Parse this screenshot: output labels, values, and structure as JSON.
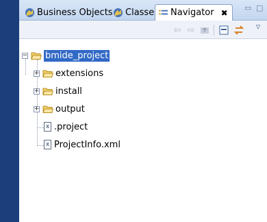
{
  "tabs": [
    {
      "label": "Business Objects",
      "icon": "business-objects-icon"
    },
    {
      "label": "Classes",
      "icon": "classes-icon"
    },
    {
      "label": "Navigator",
      "icon": "navigator-icon",
      "active": true,
      "close": "✖"
    }
  ],
  "window_controls": {
    "minimize": "▭",
    "maximize": "□",
    "menu": "▿"
  },
  "toolbar": {
    "back_icon": "back-arrow-icon",
    "forward_icon": "forward-arrow-icon",
    "up_icon": "up-folder-icon",
    "collapse_icon": "collapse-all-icon",
    "link_icon": "link-with-editor-icon"
  },
  "tree": {
    "root": {
      "label": "bmide_project",
      "expanded": true,
      "selected": true
    },
    "children": [
      {
        "label": "extensions",
        "type": "folder",
        "expander": "+"
      },
      {
        "label": "install",
        "type": "folder",
        "expander": "+"
      },
      {
        "label": "output",
        "type": "folder",
        "expander": "+"
      },
      {
        "label": ".project",
        "type": "file",
        "icon_text": "x"
      },
      {
        "label": "ProjectInfo.xml",
        "type": "file",
        "icon_text": "x"
      }
    ]
  },
  "colors": {
    "selection": "#3169c6",
    "left_bar": "#1b3f7a",
    "tab_bar": "#c3d6ef"
  }
}
